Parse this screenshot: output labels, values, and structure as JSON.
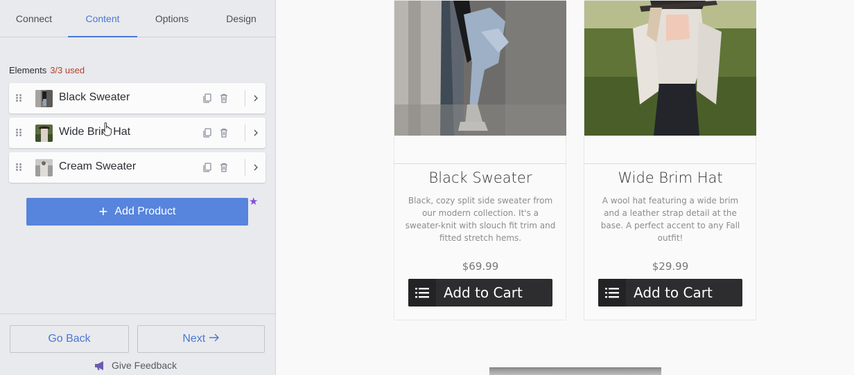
{
  "tabs": [
    "Connect",
    "Content",
    "Options",
    "Design"
  ],
  "active_tab": "Content",
  "elements": {
    "heading": "Elements",
    "usage": "3/3 used",
    "items": [
      {
        "label": "Black Sweater",
        "thumb": "black-sweater-thumbnail"
      },
      {
        "label": "Wide Brim Hat",
        "thumb": "wide-brim-hat-thumbnail"
      },
      {
        "label": "Cream Sweater",
        "thumb": "cream-sweater-thumbnail"
      }
    ]
  },
  "add_product_label": "Add Product",
  "footer": {
    "back_label": "Go Back",
    "next_label": "Next",
    "feedback_label": "Give Feedback"
  },
  "products": [
    {
      "title": "Black Sweater",
      "description": "Black, cozy split side sweater from our modern collection. It's a sweater-knit with slouch fit trim and fitted stretch hems.",
      "price": "$69.99",
      "cart_label": "Add to Cart"
    },
    {
      "title": "Wide Brim Hat",
      "description": "A wool hat featuring a wide brim and a leather strap detail at the base. A perfect accent to any Fall outfit!",
      "price": "$29.99",
      "cart_label": "Add to Cart"
    }
  ],
  "colors": {
    "accent": "#5784dc",
    "used_badge": "#b3412c",
    "star": "#8a4bd8",
    "cart_button": "#2d2d2f"
  },
  "icons": [
    "drag-handle-icon",
    "copy-icon",
    "trash-icon",
    "chevron-right-icon",
    "plus-icon",
    "star-icon",
    "arrow-right-icon",
    "megaphone-icon",
    "list-icon",
    "hand-cursor-icon"
  ]
}
